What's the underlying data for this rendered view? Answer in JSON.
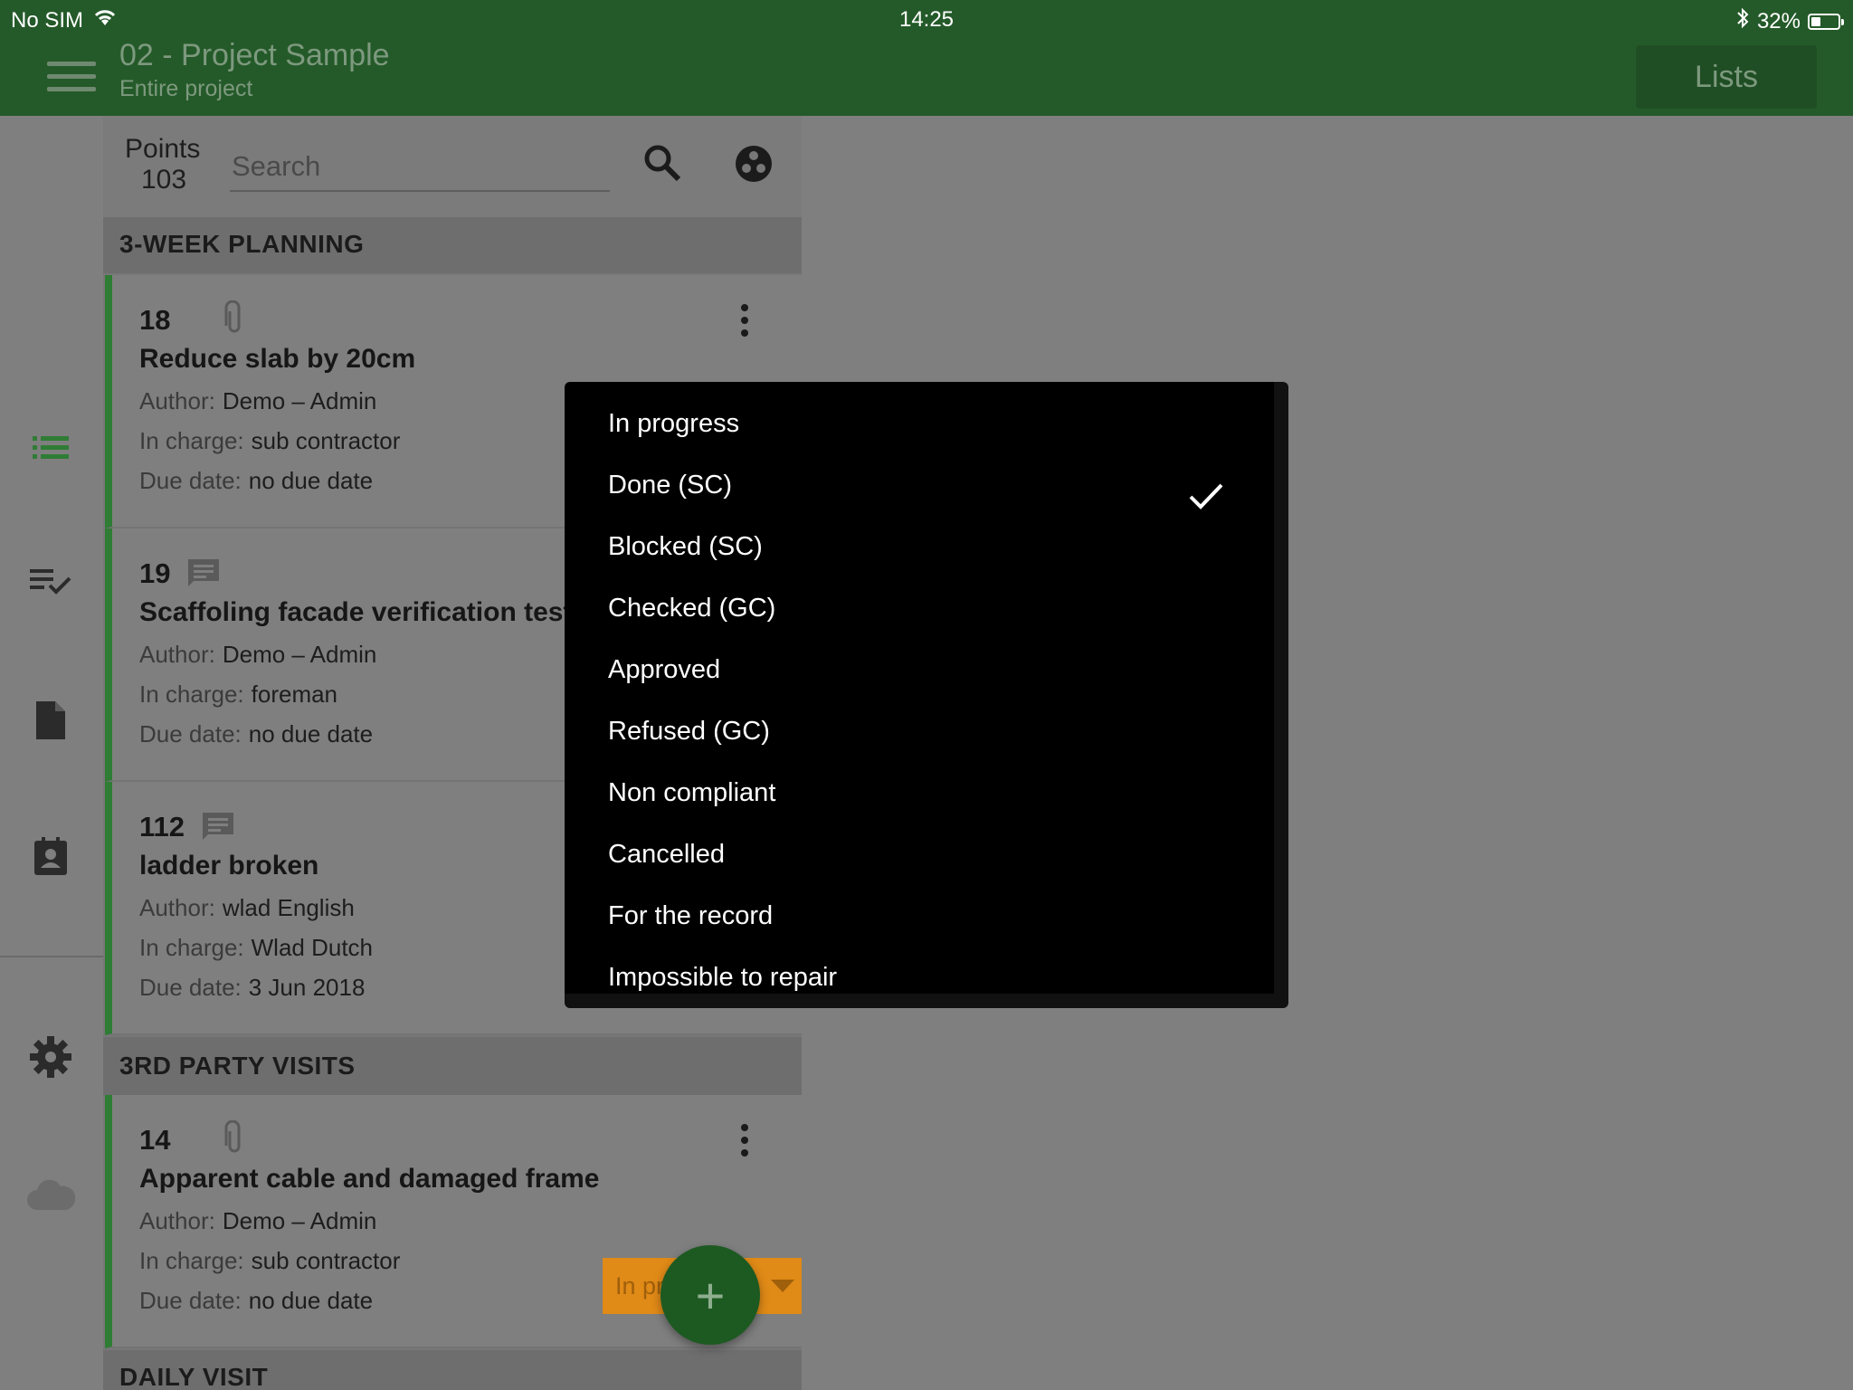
{
  "status_bar": {
    "carrier": "No SIM",
    "time": "14:25",
    "battery": "32%"
  },
  "header": {
    "title": "02 - Project Sample",
    "subtitle": "Entire project",
    "lists_button": "Lists"
  },
  "rail": {
    "icons": [
      "list-icon",
      "checklist-icon",
      "document-icon",
      "contact-icon",
      "gear-icon",
      "cloud-icon"
    ]
  },
  "list_header": {
    "points_label": "Points",
    "points_count": "103",
    "search_placeholder": "Search"
  },
  "field_labels": {
    "author": "Author:",
    "in_charge": "In charge:",
    "due_date": "Due date:"
  },
  "sections": [
    {
      "title": "3-WEEK PLANNING",
      "cards": [
        {
          "number": "18",
          "title": "Reduce slab by 20cm",
          "author": "Demo – Admin",
          "in_charge": "sub contractor",
          "due_date": "no due date",
          "attachment": "paperclip"
        },
        {
          "number": "19",
          "title": "Scaffoling facade verification test",
          "author": "Demo – Admin",
          "in_charge": "foreman",
          "due_date": "no due date",
          "attachment": "comment"
        },
        {
          "number": "112",
          "title": "ladder broken",
          "author": "wlad English",
          "in_charge": "Wlad Dutch",
          "due_date": "3 Jun 2018",
          "attachment": "comment"
        }
      ]
    },
    {
      "title": "3RD PARTY VISITS",
      "cards": [
        {
          "number": "14",
          "title": "Apparent cable and damaged frame",
          "author": "Demo – Admin",
          "in_charge": "sub contractor",
          "due_date": "no due date",
          "attachment": "paperclip",
          "status_chip": "In pr"
        }
      ]
    },
    {
      "title": "DAILY VISIT",
      "cards": []
    }
  ],
  "fab_label": "+",
  "status_dropdown": {
    "selected": "Done (SC)",
    "options": [
      "In progress",
      "Done (SC)",
      "Blocked (SC)",
      "Checked (GC)",
      "Approved",
      "Refused (GC)",
      "Non compliant",
      "Cancelled",
      "For the record",
      "Impossible to repair"
    ]
  },
  "colors": {
    "app_bar": "#245a29",
    "accent_green": "#2f7c35",
    "status_orange": "#e08a17",
    "overlay_gray": "#7f7f7f"
  }
}
